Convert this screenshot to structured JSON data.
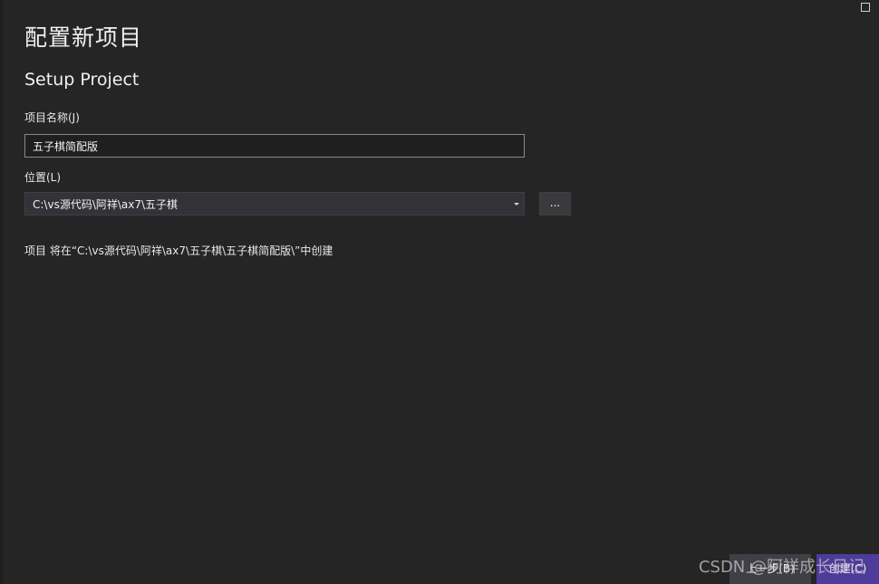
{
  "header": {
    "title": "配置新项目",
    "subtitle": "Setup Project"
  },
  "form": {
    "name_label": "项目名称(J)",
    "name_value": "五子棋简配版",
    "location_label": "位置(L)",
    "location_value": "C:\\vs源代码\\阿祥\\ax7\\五子棋",
    "browse_label": "...",
    "create_info": "项目 将在“C:\\vs源代码\\阿祥\\ax7\\五子棋\\五子棋简配版\\”中创建"
  },
  "footer": {
    "back_label": "上一步(B)",
    "create_label": "创建(C)"
  },
  "watermark": "CSDN @阿祥成长日记",
  "icons": {
    "maximize": "maximize-icon",
    "dropdown": "chevron-down-icon"
  },
  "colors": {
    "background": "#252526",
    "accent": "#4e3b9a",
    "input_border": "#8a8a8a"
  }
}
